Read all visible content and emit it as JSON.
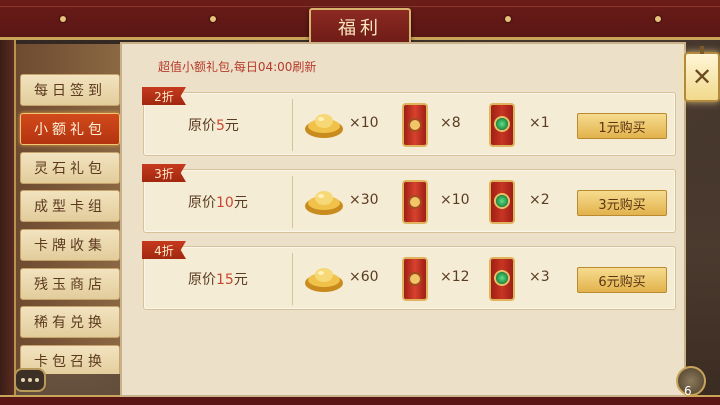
{
  "window": {
    "title": "福利"
  },
  "header": {
    "subtitle": "超值小额礼包,每日04:00刷新"
  },
  "sidebar": {
    "items": [
      {
        "label": "每日签到",
        "active": false
      },
      {
        "label": "小额礼包",
        "active": true
      },
      {
        "label": "灵石礼包",
        "active": false
      },
      {
        "label": "成型卡组",
        "active": false
      },
      {
        "label": "卡牌收集",
        "active": false
      },
      {
        "label": "残玉商店",
        "active": false
      },
      {
        "label": "稀有兑换",
        "active": false
      },
      {
        "label": "卡包召换",
        "active": false
      }
    ]
  },
  "packages": [
    {
      "discount": "2折",
      "orig_label": "原价",
      "orig_price": "5",
      "orig_unit": "元",
      "items": [
        {
          "icon": "gold-ingot-icon",
          "qty": "×10"
        },
        {
          "icon": "red-scroll-icon",
          "qty": "×8"
        },
        {
          "icon": "jade-token-icon",
          "qty": "×1"
        }
      ],
      "buy_label": "1元购买"
    },
    {
      "discount": "3折",
      "orig_label": "原价",
      "orig_price": "10",
      "orig_unit": "元",
      "items": [
        {
          "icon": "gold-ingot-icon",
          "qty": "×30"
        },
        {
          "icon": "red-scroll-icon",
          "qty": "×10"
        },
        {
          "icon": "jade-token-icon",
          "qty": "×2"
        }
      ],
      "buy_label": "3元购买"
    },
    {
      "discount": "4折",
      "orig_label": "原价",
      "orig_price": "15",
      "orig_unit": "元",
      "items": [
        {
          "icon": "gold-ingot-icon",
          "qty": "×60"
        },
        {
          "icon": "red-scroll-icon",
          "qty": "×12"
        },
        {
          "icon": "jade-token-icon",
          "qty": "×3"
        }
      ],
      "buy_label": "6元购买"
    }
  ],
  "close": {
    "glyph": "✕"
  },
  "corner": {
    "count": "6"
  },
  "colors": {
    "accent": "#b8392c",
    "active_tab": "#c6391e",
    "buy_button": "#e2b24c"
  }
}
